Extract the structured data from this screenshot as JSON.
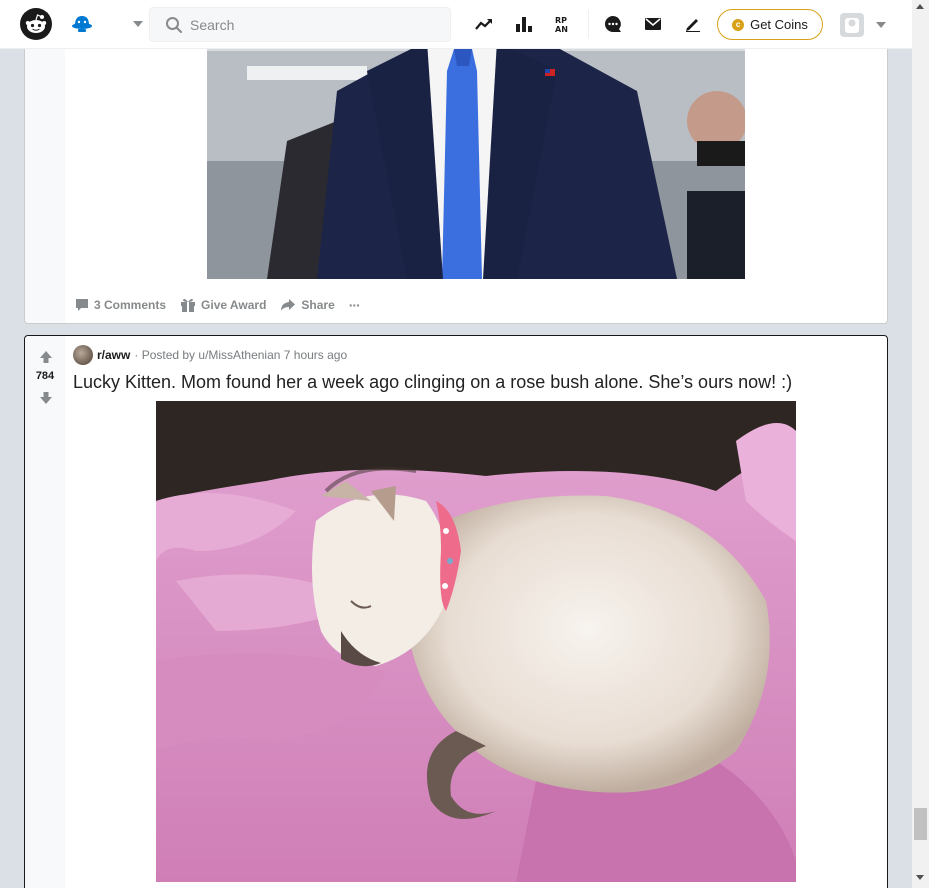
{
  "header": {
    "search_placeholder": "Search",
    "get_coins_label": "Get Coins"
  },
  "colors": {
    "accent": "#0079d3",
    "coin_gold": "#d7a11a",
    "vote_gray": "#878a8c"
  },
  "post_top": {
    "actions": {
      "comments": "3 Comments",
      "award": "Give Award",
      "share": "Share",
      "more": "···"
    }
  },
  "post_kitten": {
    "score": "784",
    "subreddit": "r/aww",
    "posted_by": "· Posted by u/MissAthenian 7 hours ago",
    "title": "Lucky Kitten. Mom found her a week ago clinging on a rose bush alone. She’s ours now! :)"
  }
}
